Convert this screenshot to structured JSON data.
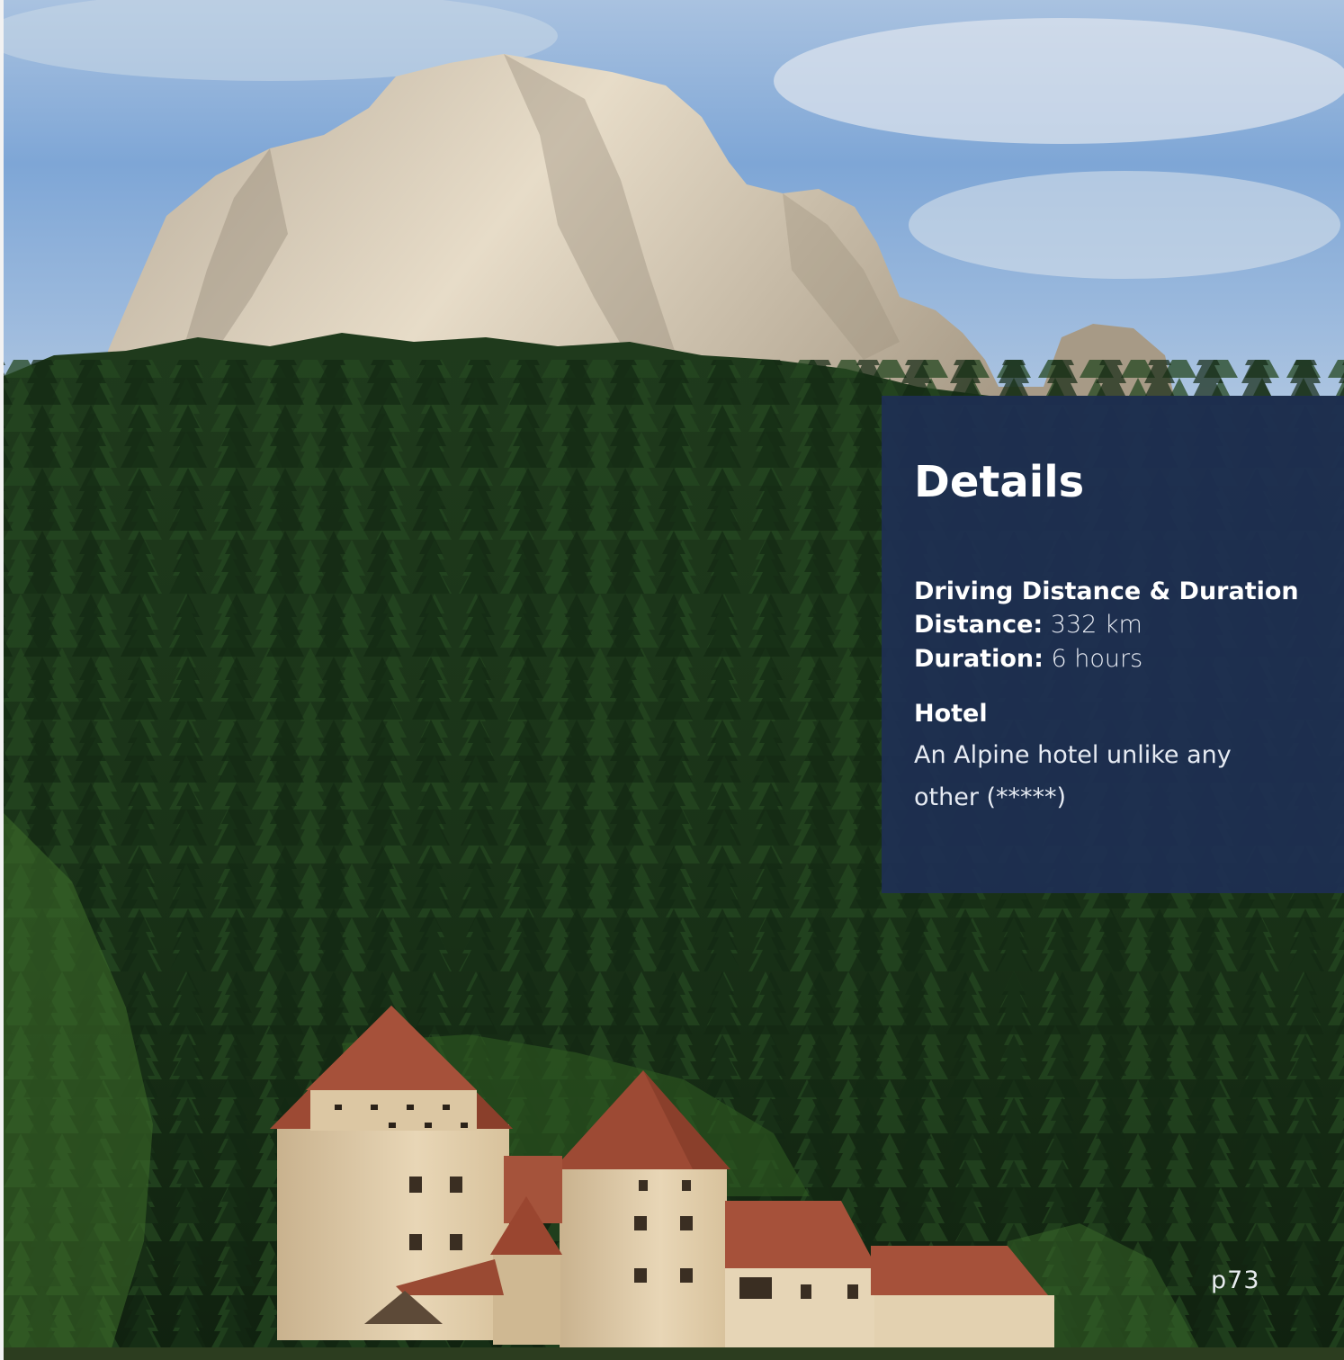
{
  "details": {
    "title": "Details",
    "driving": {
      "heading": "Driving Distance & Duration",
      "distance_label": "Distance:",
      "distance_value": "332 km",
      "duration_label": "Duration:",
      "duration_value": "6 hours"
    },
    "hotel": {
      "heading": "Hotel",
      "description": "An Alpine hotel unlike any other (*****)"
    }
  },
  "page_number": "p73",
  "colors": {
    "panel": "#1e2f54",
    "text": "#ffffff",
    "sky": "#7ea6d6",
    "forest": "#1a3317",
    "castle_wall": "#e3cfae",
    "roof": "#9d4a34"
  }
}
